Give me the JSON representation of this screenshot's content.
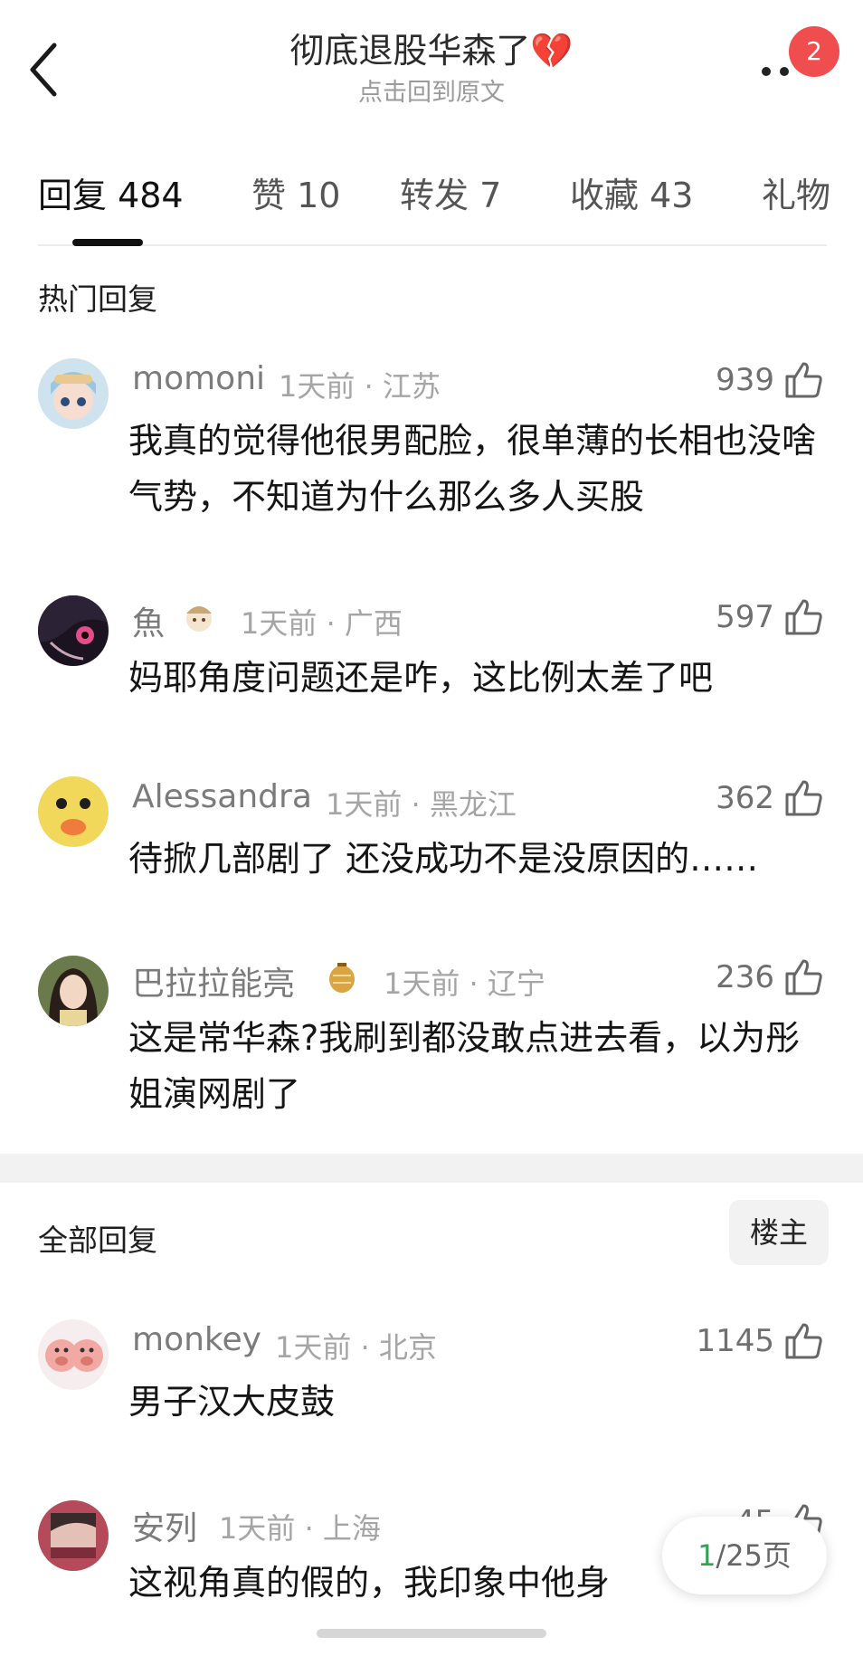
{
  "header": {
    "title": "彻底退股华森了💔",
    "subtitle": "点击回到原文",
    "badge_count": "2"
  },
  "tabs": [
    {
      "label": "回复 484",
      "active": true
    },
    {
      "label": "赞 10",
      "active": false
    },
    {
      "label": "转发 7",
      "active": false
    },
    {
      "label": "收藏 43",
      "active": false
    },
    {
      "label": "礼物",
      "active": false
    }
  ],
  "hot_section": {
    "title": "热门回复",
    "comments": [
      {
        "name": "momoni",
        "time": "1天前",
        "location": "江苏",
        "likes": "939",
        "text": "我真的觉得他很男配脸，很单薄的长相也没啥气势，不知道为什么那么多人买股",
        "avatar": "cartoon-girl-avatar"
      },
      {
        "name": "魚",
        "time": "1天前",
        "location": "广西",
        "likes": "597",
        "text": "妈耶角度问题还是咋，这比例太差了吧",
        "avatar": "anime-girl-avatar"
      },
      {
        "name": "Alessandra",
        "time": "1天前",
        "location": "黑龙江",
        "likes": "362",
        "text": "待掀几部剧了  还没成功不是没原因的……",
        "avatar": "duck-avatar"
      },
      {
        "name": "巴拉拉能亮",
        "time": "1天前",
        "location": "辽宁",
        "likes": "236",
        "text": "这是常华森?我刷到都没敢点进去看，以为彤姐演网剧了",
        "avatar": "woman-avatar"
      }
    ]
  },
  "all_section": {
    "title": "全部回复",
    "owner_button": "楼主",
    "comments": [
      {
        "name": "monkey",
        "time": "1天前",
        "location": "北京",
        "likes": "1145",
        "text": "男子汉大皮鼓",
        "avatar": "pig-avatar"
      },
      {
        "name": "安列",
        "time": "1天前",
        "location": "上海",
        "likes": "45",
        "text": "这视角真的假的，我印象中他身",
        "avatar": "photo-avatar"
      }
    ]
  },
  "pager": {
    "current": "1",
    "total_text": "/25页"
  },
  "colors": {
    "badge": "#f04e4e",
    "pager_current": "#2ea44f"
  }
}
